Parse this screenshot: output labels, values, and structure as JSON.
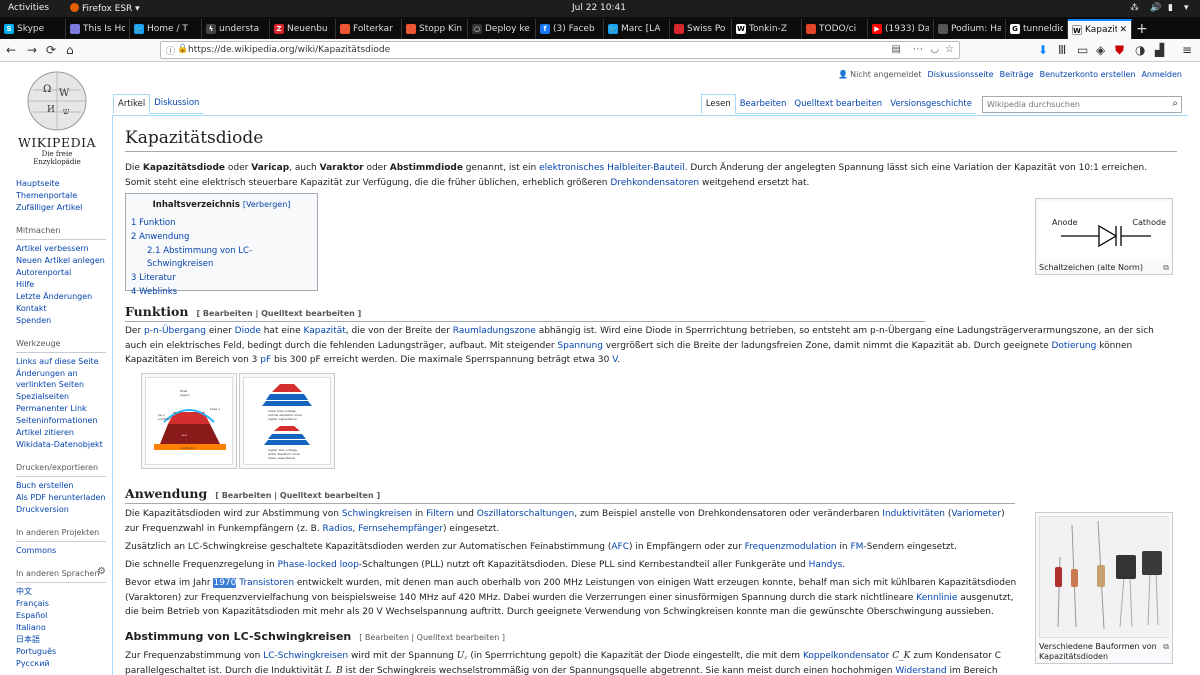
{
  "system": {
    "activities": "Activities",
    "app": "Firefox ESR ▾",
    "clock": "Jul 22  10:41"
  },
  "tabs": [
    {
      "title": "Skype",
      "color": "#00aff0",
      "glyph": "S"
    },
    {
      "title": "This Is Ho",
      "color": "#7b7bdb",
      "glyph": ""
    },
    {
      "title": "Home / T",
      "color": "#1da1f2",
      "glyph": "🐦"
    },
    {
      "title": "understa",
      "color": "#444",
      "glyph": "ϟ"
    },
    {
      "title": "Neuenbu",
      "color": "#d9262c",
      "glyph": "Z"
    },
    {
      "title": "Folterkar",
      "color": "#e53",
      "glyph": ""
    },
    {
      "title": "Stopp Kin",
      "color": "#e53",
      "glyph": ""
    },
    {
      "title": "Deploy ke",
      "color": "#333",
      "glyph": "○"
    },
    {
      "title": "(3) Faceb",
      "color": "#1877f2",
      "glyph": "f"
    },
    {
      "title": "Marc [LA",
      "color": "#1da1f2",
      "glyph": "🐦"
    },
    {
      "title": "Swiss Po",
      "color": "#d9262c",
      "glyph": ""
    },
    {
      "title": "Tonkin-Z",
      "color": "#fff",
      "glyph": "W"
    },
    {
      "title": "TODO/ci",
      "color": "#e24329",
      "glyph": ""
    },
    {
      "title": "(1933) Da",
      "color": "#f00",
      "glyph": "▶"
    },
    {
      "title": "Podium: Hac",
      "color": "#555",
      "glyph": ""
    },
    {
      "title": "tunneldic",
      "color": "#fff",
      "glyph": "G"
    }
  ],
  "active_tab": {
    "title": "Kapazit",
    "glyph": "W"
  },
  "url": "https://de.wikipedia.org/wiki/Kapazitätsdiode",
  "logo": {
    "name": "WIKIPEDIA",
    "tagline": "Die freie Enzyklopädie"
  },
  "personal": [
    "Nicht angemeldet",
    "Diskussionsseite",
    "Beiträge",
    "Benutzerkonto erstellen",
    "Anmelden"
  ],
  "ns_tabs": [
    "Artikel",
    "Diskussion"
  ],
  "view_tabs": [
    "Lesen",
    "Bearbeiten",
    "Quelltext bearbeiten",
    "Versionsgeschichte"
  ],
  "search_placeholder": "Wikipedia durchsuchen",
  "sidebar": {
    "main": [
      "Hauptseite",
      "Themenportale",
      "Zufälliger Artikel"
    ],
    "mitmachen_title": "Mitmachen",
    "mitmachen": [
      "Artikel verbessern",
      "Neuen Artikel anlegen",
      "Autorenportal",
      "Hilfe",
      "Letzte Änderungen",
      "Kontakt",
      "Spenden"
    ],
    "werkzeuge_title": "Werkzeuge",
    "werkzeuge": [
      "Links auf diese Seite",
      "Änderungen an verlinkten Seiten",
      "Spezialseiten",
      "Permanenter Link",
      "Seiteninformationen",
      "Artikel zitieren",
      "Wikidata-Datenobjekt"
    ],
    "drucken_title": "Drucken/exportieren",
    "drucken": [
      "Buch erstellen",
      "Als PDF herunterladen",
      "Druckversion"
    ],
    "projekte_title": "In anderen Projekten",
    "projekte": [
      "Commons"
    ],
    "sprachen_title": "In anderen Sprachen",
    "sprachen": [
      "中文",
      "Français",
      "Español",
      "Italiano",
      "日本語",
      "Português",
      "Русский"
    ]
  },
  "article": {
    "title": "Kapazitätsdiode",
    "intro_1": "Die ",
    "intro_b1": "Kapazitätsdiode",
    "intro_2": " oder ",
    "intro_b2": "Varicap",
    "intro_3": ", auch ",
    "intro_b3": "Varaktor",
    "intro_4": " oder ",
    "intro_b4": "Abstimmdiode",
    "intro_5": " genannt, ist ein ",
    "intro_l1": "elektronisches Halbleiter-Bauteil",
    "intro_6": ". Durch Änderung der angelegten Spannung lässt sich eine Variation der Kapazität von 10:1 erreichen. Somit steht eine elektrisch steuerbare Kapazität zur Verfügung, die die früher üblichen, erheblich größeren ",
    "intro_l2": "Drehkondensatoren",
    "intro_7": " weitgehend ersetzt hat.",
    "toc_title": "Inhaltsverzeichnis",
    "toc_hide": "[Verbergen]",
    "toc": [
      "1 Funktion",
      "2 Anwendung",
      "2.1 Abstimmung von LC-Schwingkreisen",
      "3 Literatur",
      "4 Weblinks"
    ],
    "symbol_anode": "Anode",
    "symbol_cathode": "Cathode",
    "symbol_caption": "Schaltzeichen (alte Norm)",
    "edit_links": "[ Bearbeiten | Quelltext bearbeiten ]",
    "h_funktion": "Funktion",
    "funk_1": "Der ",
    "funk_l1": "p-n-Übergang",
    "funk_2": " einer ",
    "funk_l2": "Diode",
    "funk_3": " hat eine ",
    "funk_l3": "Kapazität",
    "funk_4": ", die von der Breite der ",
    "funk_l4": "Raumladungszone",
    "funk_5": " abhängig ist. Wird eine Diode in Sperrrichtung betrieben, so entsteht am p-n-Übergang eine Ladungsträgerverarmungszone, an der sich auch ein elektrisches Feld, bedingt durch die fehlenden Ladungsträger, aufbaut. Mit steigender ",
    "funk_l5": "Spannung",
    "funk_6": " vergrößert sich die Breite der ladungsfreien Zone, damit nimmt die Kapazität ab. Durch geeignete ",
    "funk_l6": "Dotierung",
    "funk_7": " können Kapazitäten im Bereich von 3 ",
    "funk_l7": "pF",
    "funk_8": " bis 300 pF erreicht werden. Die maximale Sperrspannung beträgt etwa 30  ",
    "funk_l8": "V",
    "funk_9": ".",
    "h_anwendung": "Anwendung",
    "anw1_1": "Die Kapazitätsdioden wird zur Abstimmung von ",
    "anw1_l1": "Schwingkreisen",
    "anw1_2": " in ",
    "anw1_l2": "Filtern",
    "anw1_3": " und ",
    "anw1_l3": "Oszillatorschaltungen",
    "anw1_4": ", zum Beispiel anstelle von Drehkondensatoren oder veränderbaren ",
    "anw1_l4": "Induktivitäten",
    "anw1_5": " (",
    "anw1_l5": "Variometer",
    "anw1_6": ") zur Frequenzwahl in Funkempfängern (z.  B. ",
    "anw1_l6": "Radios",
    "anw1_7": ", ",
    "anw1_l7": "Fernsehempfänger",
    "anw1_8": ") eingesetzt.",
    "anw2_1": "Zusätzlich an LC-Schwingkreise geschaltete Kapazitätsdioden werden zur Automatischen Feinabstimmung (",
    "anw2_l1": "AFC",
    "anw2_2": ") in Empfängern oder zur ",
    "anw2_l2": "Frequenzmodulation",
    "anw2_3": " in ",
    "anw2_l3": "FM",
    "anw2_4": "-Sendern eingesetzt.",
    "anw3_1": "Die schnelle Frequenzregelung in ",
    "anw3_l1": "Phase-locked loop",
    "anw3_2": "-Schaltungen (PLL) nutzt oft Kapazitätsdioden. Diese PLL sind Kernbestandteil aller Funkgeräte und ",
    "anw3_l2": "Handys",
    "anw3_3": ".",
    "anw4_1": "Bevor etwa im Jahr ",
    "anw4_sel": "1970",
    "anw4_2": " ",
    "anw4_l1": "Transistoren",
    "anw4_3": " entwickelt wurden, mit denen man auch oberhalb von 200  MHz Leistungen von einigen Watt erzeugen konnte, behalf man sich mit kühlbaren Kapazitätsdioden (Varaktoren) zur Frequenzvervielfachung von beispielsweise 140  MHz auf 420  MHz. Dabei wurden die Verzerrungen einer sinusförmigen Spannung durch die stark nichtlineare ",
    "anw4_l2": "Kennlinie",
    "anw4_4": " ausgenutzt, die beim Betrieb von Kapazitätsdioden mit mehr als 20  V Wechselspannung auftritt. Durch geeignete Verwendung von Schwingkreisen konnte man die gewünschte Oberschwingung aussieben.",
    "h_abstimmung": "Abstimmung von LC-Schwingkreisen",
    "abs_1": "Zur Frequenzabstimmung von ",
    "abs_l1": "LC-Schwingkreisen",
    "abs_2": " wird mit der Spannung ",
    "abs_m1": "U꜀",
    "abs_3": " (in Sperrrichtung gepolt) die Kapazität der Diode eingestellt, die mit dem ",
    "abs_l2": "Koppelkondensator",
    "abs_4": " ",
    "abs_m2": "C_K",
    "abs_5": " zum Kondensator C parallelgeschaltet ist. Durch die Induktivität ",
    "abs_m3": "L_B",
    "abs_6": " ist der Schwingkreis wechselstrommäßig von der Spannungsquelle abgetrennt. Sie kann meist durch einen hochohmigen ",
    "abs_l3": "Widerstand",
    "abs_7": " im Bereich von",
    "photo_caption": "Verschiedene Bauformen von Kapazitätsdioden",
    "img1_labels": [
      "fixed",
      "region",
      "pe-n",
      "junction",
      "base n",
      "p-n",
      "conductor"
    ],
    "img2_labels": [
      "lower bias voltage,",
      "narrow depletion zone,",
      "higher capacitance",
      "higher bias voltage,",
      "wider depletion zone,",
      "lower capacitance"
    ]
  },
  "colors": {
    "link": "#0645ad",
    "accent": "#0a84ff"
  }
}
